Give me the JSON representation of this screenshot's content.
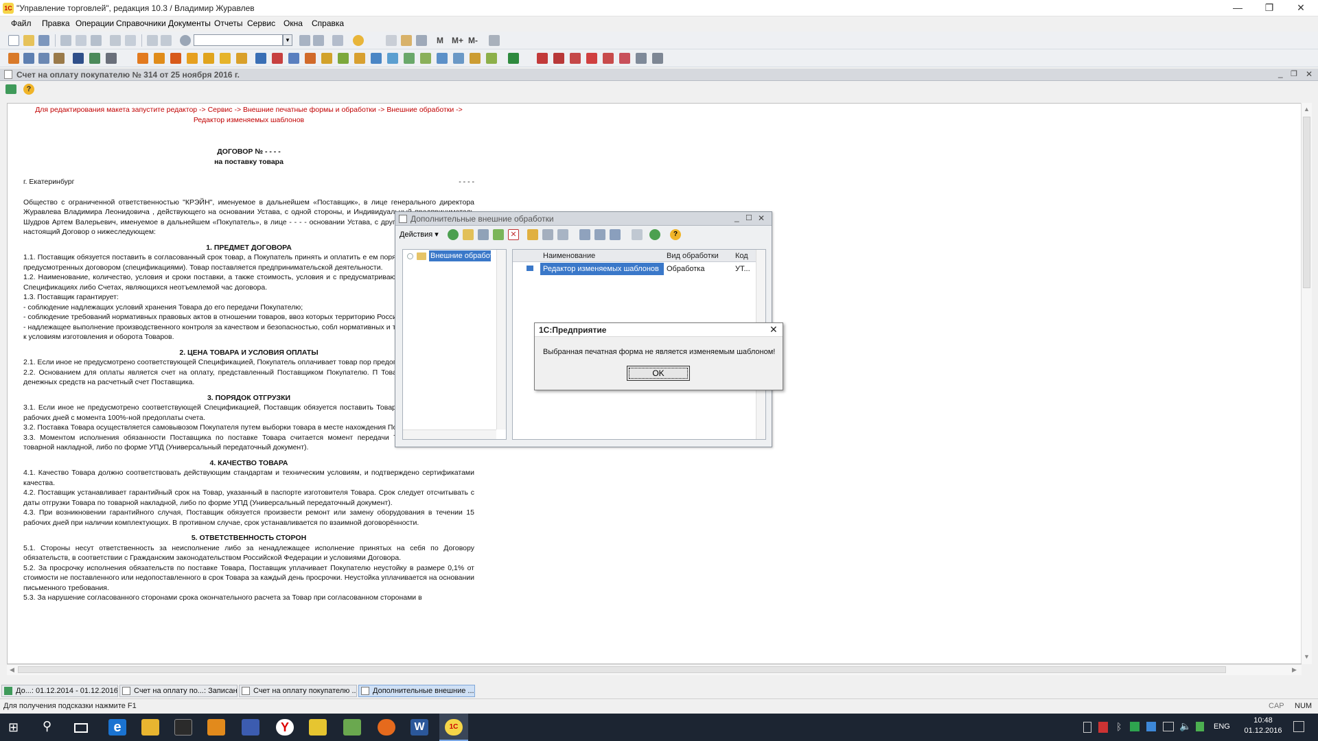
{
  "window": {
    "title": "\"Управление торговлей\", редакция 10.3 / Владимир Журавлев",
    "minimize": "—",
    "restore": "❐",
    "close": "✕"
  },
  "menu": [
    "Файл",
    "Правка",
    "Операции",
    "Справочники",
    "Документы",
    "Отчеты",
    "Сервис",
    "Окна",
    "Справка"
  ],
  "toolbar": {
    "m": "M",
    "m_plus": "M+",
    "m_minus": "M-"
  },
  "document_window": {
    "title": "Счет на оплату покупателю № 314 от 25 ноября 2016 г."
  },
  "doc": {
    "note": "Для редактирования макета запустите редактор -> Сервис -> Внешние печатные формы и обработки -> Внешние обработки -> Редактор изменяемых шаблонов",
    "title": "ДОГОВОР № - - - -",
    "subtitle": "на поставку товара",
    "city": "г. Екатеринбург",
    "date_placeholder": "- - - -",
    "intro": "Общество с ограниченной ответственностью \"КРЭЙН\", именуемое в дальнейшем «Поставщик», в лице генерального директора Журавлева Владимира Леонидовича , действующего на основании Устава, с одной стороны, и Индивидуальный предприниматель Шудров Артем Валерьевич, именуемое в дальнейшем «Покупатель», в лице - - - - основании Устава, с другой стороны, заключили настоящий Договор о нижеследующем:",
    "s1": "1. ПРЕДМЕТ ДОГОВОРА",
    "p1_1": "1.1. Поставщик обязуется поставить в согласованный срок товар, а Покупатель принять и оплатить е ем порядка и формы расчетов, предусмотренных договором (спецификациями). Товар поставляется предпринимательской деятельности.",
    "p1_2": "1.2. Наименование, количество, условия и сроки поставки, а также стоимость, условия и с предусматриваются в соответствующих Спецификациях либо Счетах, являющихся неотъемлемой час договора.",
    "p1_3": "1.3. Поставщик гарантирует:",
    "p1_3a": " - соблюдение надлежащих условий хранения Товара до его передачи Покупателю;",
    "p1_3b": " - соблюдение требований нормативных правовых актов в отношении товаров, ввоз которых территорию Российской Федерации;",
    "p1_3c": " - надлежащее выполнение производственного контроля за качеством и безопасностью, собл нормативных и технических документов к условиям изготовления и оборота Товаров.",
    "s2": "2. ЦЕНА ТОВАРА И УСЛОВИЯ ОПЛАТЫ",
    "p2_1": "2.1. Если иное не предусмотрено соответствующей Спецификацией, Покупатель оплачивает товар пор предоплаты.",
    "p2_2": "2.2. Основанием для оплаты является счет на оплату, представленный Поставщиком Покупателю. П Товар путем перечисления денежных средств на расчетный счет Поставщика.",
    "s3": "3. ПОРЯДОК ОТГРУЗКИ",
    "p3_1": "3.1. Если иное не предусмотрено соответствующей Спецификацией, Поставщик обязуется поставить Товар в течение 10 (десяти) рабочих дней с момента 100%-ной предоплаты счета.",
    "p3_2": "3.2. Поставка Товара осуществляется самовывозом Покупателя путем выборки товара в месте нахождения Поставщика.",
    "p3_3": "3.3. Моментом исполнения обязанности Поставщика по поставке Товара считается момент передачи Товара Покупателю по товарной накладной, либо по форме УПД (Универсальный передаточный документ).",
    "s4": "4. КАЧЕСТВО ТОВАРА",
    "p4_1": "4.1. Качество Товара должно соответствовать действующим стандартам и техническим условиям, и подтверждено сертификатами качества.",
    "p4_2": "4.2. Поставщик устанавливает гарантийный срок на Товар, указанный в паспорте изготовителя Товара. Срок следует отсчитывать с даты отгрузки Товара по товарной накладной, либо по форме УПД (Универсальный передаточный документ).",
    "p4_3": "4.3. При возникновении гарантийного случая, Поставщик обязуется произвести ремонт или замену оборудования в течении 15 рабочих дней при наличии комплектующих. В противном случае, срок устанавливается по взаимной договорённости.",
    "s5": "5. ОТВЕТСТВЕННОСТЬ СТОРОН",
    "p5_1": "5.1. Стороны несут ответственность за неисполнение либо за ненадлежащее исполнение принятых на себя по Договору обязательств, в соответствии с Гражданским законодательством Российской Федерации и условиями Договора.",
    "p5_2": "5.2. За просрочку исполнения обязательств по поставке Товара, Поставщик уплачивает Покупателю неустойку в размере 0,1% от стоимости не поставленного или недопоставленного в срок Товара за каждый день просрочки. Неустойка уплачивается на основании письменного требования.",
    "p5_3": "5.3. За нарушение согласованного сторонами срока окончательного расчета за Товар при согласованном сторонами в"
  },
  "ext_dialog": {
    "title": "Дополнительные внешние обработки",
    "actions": "Действия",
    "tree_item": "Внешние обработ",
    "columns": [
      "Наименование",
      "Вид обработки",
      "Код"
    ],
    "row": {
      "name": "Редактор изменяемых шаблонов",
      "kind": "Обработка",
      "code": "УТ..."
    }
  },
  "message": {
    "title": "1С:Предприятие",
    "text": "Выбранная печатная форма не является изменяемым шаблоном!",
    "ok": "OK"
  },
  "window_tabs": [
    "До...: 01.12.2014 - 01.12.2016",
    "Счет на оплату по...: Записан",
    "Счет на оплату покупателю ...",
    "Дополнительные внешние ..."
  ],
  "status": {
    "hint": "Для получения подсказки нажмите F1",
    "cap": "CAP",
    "num": "NUM"
  },
  "taskbar": {
    "lang": "ENG",
    "time": "10:48",
    "date": "01.12.2016"
  }
}
